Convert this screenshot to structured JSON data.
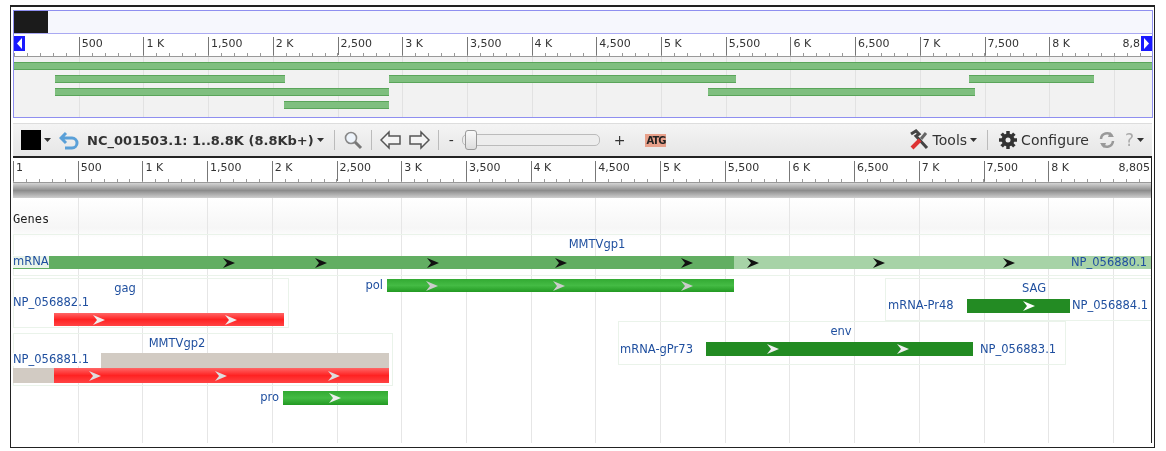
{
  "overview": {
    "ticks": [
      "500",
      "1 K",
      "1,500",
      "2 K",
      "2,500",
      "3 K",
      "3,500",
      "4 K",
      "4,500",
      "5 K",
      "5,500",
      "6 K",
      "6,500",
      "7 K",
      "7,500",
      "8 K"
    ],
    "end": "8,8"
  },
  "toolbar": {
    "location": "NC_001503.1: 1..8.8K (8.8Kb+)",
    "zoom_out": "-",
    "zoom_in": "+",
    "level": 0.05,
    "sequence": "ATG",
    "tools": "Tools",
    "configure": "Configure",
    "help": "?"
  },
  "ruler": {
    "start": "1",
    "ticks": [
      "500",
      "1 K",
      "1,500",
      "2 K",
      "2,500",
      "3 K",
      "3,500",
      "4 K",
      "4,500",
      "5 K",
      "5,500",
      "6 K",
      "6,500",
      "7 K",
      "7,500",
      "8 K"
    ],
    "end": "8,805"
  },
  "track": {
    "title": "Genes",
    "features": [
      {
        "kind": "gene",
        "name": "MMTVgp1",
        "left_label": "mRNA",
        "right_label": "NP_056880.1"
      },
      {
        "kind": "gene",
        "name": "gag",
        "left_label": "NP_056882.1"
      },
      {
        "kind": "plain",
        "name": "pol"
      },
      {
        "kind": "gene",
        "name": "SAG",
        "left_label": "mRNA-Pr48",
        "right_label": "NP_056884.1"
      },
      {
        "kind": "gene",
        "name": "env",
        "left_label": "mRNA-gPr73",
        "right_label": "NP_056883.1"
      },
      {
        "kind": "gene",
        "name": "MMTVgp2",
        "left_label": "NP_056881.1"
      },
      {
        "kind": "plain",
        "name": "pro"
      }
    ]
  }
}
